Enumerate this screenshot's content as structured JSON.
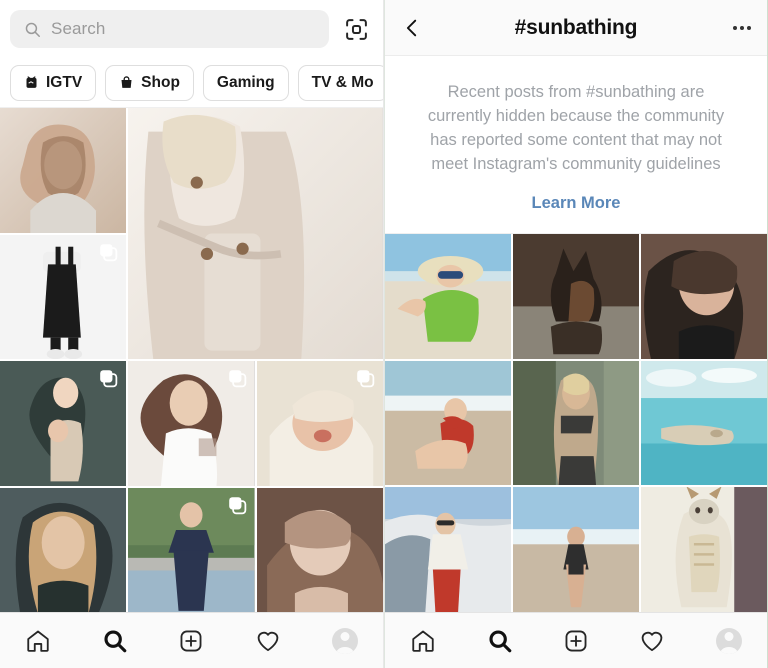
{
  "explore": {
    "search": {
      "placeholder": "Search",
      "icon": "search-icon",
      "scan_icon": "nametag-scan-icon"
    },
    "chips": [
      {
        "label": "IGTV",
        "icon": "igtv-icon"
      },
      {
        "label": "Shop",
        "icon": "shop-bag-icon"
      },
      {
        "label": "Gaming",
        "icon": ""
      },
      {
        "label": "TV & Mo",
        "icon": ""
      }
    ],
    "tiles": [
      {
        "alt": "Blonde woman portrait in grey blazer",
        "multi": false,
        "c1": "#c9a58a",
        "c2": "#e7dcd2",
        "c3": "#8f6a4e"
      },
      {
        "alt": "Woman in beige trench coat closeup",
        "multi": false,
        "c1": "#efe7df",
        "c2": "#ded2c6",
        "c3": "#f7f3ee"
      },
      {
        "alt": "Black overalls outfit on white",
        "multi": true,
        "c1": "#f4f4f4",
        "c2": "#e6e6e6",
        "c3": "#1b1b1b"
      },
      {
        "alt": "Illustration mother holding baby",
        "multi": true,
        "c1": "#4a5a56",
        "c2": "#2f3c39",
        "c3": "#d8c9b5"
      },
      {
        "alt": "Dark haired woman with arm tattoo",
        "multi": true,
        "c1": "#f0ece7",
        "c2": "#d9cfc6",
        "c3": "#6b4a3c"
      },
      {
        "alt": "Newborn baby in white hat yawning",
        "multi": true,
        "c1": "#e9e2d4",
        "c2": "#d6ccb9",
        "c3": "#c99d87"
      },
      {
        "alt": "Blonde model street portrait",
        "multi": false,
        "c1": "#4e5c5e",
        "c2": "#2d3638",
        "c3": "#c9a477"
      },
      {
        "alt": "Woman in navy floral off-shoulder dress",
        "multi": true,
        "c1": "#5d7b52",
        "c2": "#2b3550",
        "c3": "#9db7c9"
      },
      {
        "alt": "Selfie woman tilting head indoors",
        "multi": false,
        "c1": "#b49480",
        "c2": "#6d5346",
        "c3": "#e4cbb9"
      }
    ],
    "tabbar": [
      {
        "name": "home-tab",
        "icon": "home-icon",
        "active": false
      },
      {
        "name": "search-tab",
        "icon": "search-icon",
        "active": true
      },
      {
        "name": "create-tab",
        "icon": "plus-box-icon",
        "active": false
      },
      {
        "name": "activity-tab",
        "icon": "heart-icon",
        "active": false
      },
      {
        "name": "profile-tab",
        "icon": "avatar-icon",
        "active": false
      }
    ]
  },
  "hashtag": {
    "header": {
      "back_icon": "chevron-left-icon",
      "title": "#sunbathing",
      "more_icon": "more-options-icon"
    },
    "notice": {
      "text": "Recent posts from #sunbathing are currently hidden because the community has reported some content that may not meet Instagram's community guidelines",
      "link_label": "Learn More",
      "link_color": "#5a87b8",
      "text_color": "#9fa3a8"
    },
    "tiles": [
      {
        "alt": "Woman in green cover-up and sun hat lying on beach",
        "c1": "#8fc3e0",
        "c2": "#e4dccb",
        "c3": "#7ac143"
      },
      {
        "alt": "Doberman dog lying on patio in sun",
        "c1": "#4b3b30",
        "c2": "#2a211b",
        "c3": "#8a6a4a"
      },
      {
        "alt": "Selfie of woman with long brown hair",
        "c1": "#6a5246",
        "c2": "#2c241f",
        "c3": "#d9b39b"
      },
      {
        "alt": "Woman in red bikini sitting on sandy beach",
        "c1": "#cbbba4",
        "c2": "#9fc6d6",
        "c3": "#c0392b"
      },
      {
        "alt": "Woman in black sports bra sunbathing",
        "c1": "#7e8a78",
        "c2": "#bfa98c",
        "c3": "#3a3a38"
      },
      {
        "alt": "Turquoise sea with rocky jetty",
        "c1": "#7fd3d8",
        "c2": "#cfe9ec",
        "c3": "#d8cdb6"
      },
      {
        "alt": "Man in white ski jacket and red trousers on snow",
        "c1": "#cfd6dc",
        "c2": "#8a9aa6",
        "c3": "#c0392b"
      },
      {
        "alt": "Woman in black bikini walking on beach",
        "c1": "#9dc6e0",
        "c2": "#c8b9a4",
        "c3": "#2e2e2e"
      },
      {
        "alt": "Cat lying on its back on white fabric",
        "c1": "#efece2",
        "c2": "#d8d2c2",
        "c3": "#b79a73"
      }
    ],
    "tabbar": [
      {
        "name": "home-tab",
        "icon": "home-icon",
        "active": false
      },
      {
        "name": "search-tab",
        "icon": "search-icon",
        "active": true
      },
      {
        "name": "create-tab",
        "icon": "plus-box-icon",
        "active": false
      },
      {
        "name": "activity-tab",
        "icon": "heart-icon",
        "active": false
      },
      {
        "name": "profile-tab",
        "icon": "avatar-icon",
        "active": false
      }
    ]
  }
}
